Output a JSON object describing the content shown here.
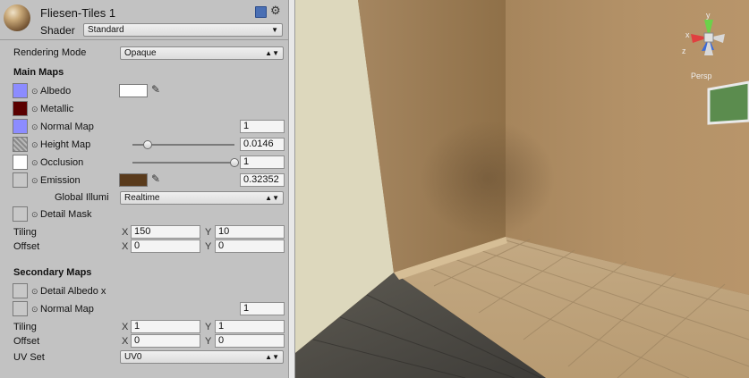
{
  "header": {
    "material_name": "Fliesen-Tiles 1",
    "shader_label": "Shader",
    "shader_value": "Standard"
  },
  "rendering_mode": {
    "label": "Rendering Mode",
    "value": "Opaque"
  },
  "main_maps": {
    "title": "Main Maps",
    "albedo": {
      "label": "Albedo",
      "color": "#ffffff"
    },
    "metallic": {
      "label": "Metallic"
    },
    "normal_map": {
      "label": "Normal Map",
      "value": "1"
    },
    "height_map": {
      "label": "Height Map",
      "value": "0.0146",
      "slider_fraction": 0.146
    },
    "occlusion": {
      "label": "Occlusion",
      "value": "1",
      "slider_fraction": 1.0
    },
    "emission": {
      "label": "Emission",
      "value": "0.32352",
      "color": "#5a3b1c"
    },
    "global_illumination": {
      "label": "Global Illumi",
      "value": "Realtime"
    },
    "detail_mask": {
      "label": "Detail Mask"
    },
    "tiling": {
      "label": "Tiling",
      "x_label": "X",
      "x": "150",
      "y_label": "Y",
      "y": "10"
    },
    "offset": {
      "label": "Offset",
      "x_label": "X",
      "x": "0",
      "y_label": "Y",
      "y": "0"
    }
  },
  "secondary_maps": {
    "title": "Secondary Maps",
    "detail_albedo": {
      "label": "Detail Albedo x"
    },
    "normal_map": {
      "label": "Normal Map",
      "value": "1"
    },
    "tiling": {
      "label": "Tiling",
      "x_label": "X",
      "x": "1",
      "y_label": "Y",
      "y": "1"
    },
    "offset": {
      "label": "Offset",
      "x_label": "X",
      "x": "0",
      "y_label": "Y",
      "y": "0"
    },
    "uv_set": {
      "label": "UV Set",
      "value": "UV0"
    }
  },
  "scene": {
    "gizmo": {
      "y_label": "y",
      "x_label": "x",
      "z_label": "z",
      "persp_label": "Persp"
    }
  },
  "colors": {
    "albedo_swatch": "#8c8cff",
    "metallic_swatch": "#5a0000",
    "normal_swatch": "#8c8cff",
    "emission": "#5a3b1c"
  },
  "icons": [
    "material-sphere-icon",
    "help-book-icon",
    "gear-icon",
    "eyedropper-icon",
    "scene-gizmo-icon"
  ]
}
